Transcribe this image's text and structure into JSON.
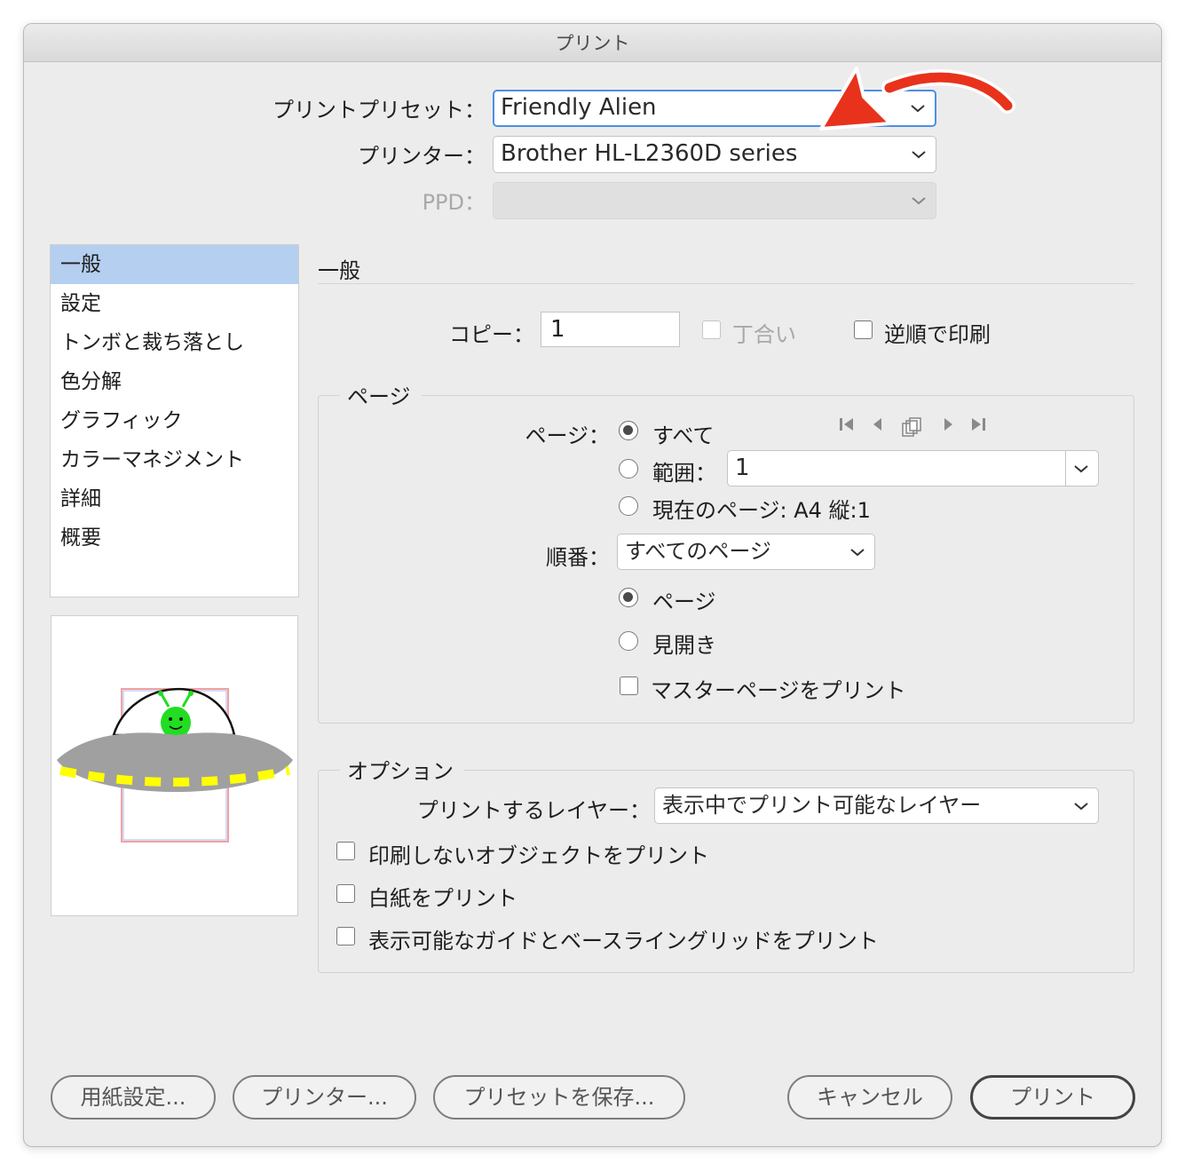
{
  "window": {
    "title": "プリント"
  },
  "preset": {
    "label": "プリントプリセット：",
    "value": "Friendly Alien"
  },
  "printer": {
    "label": "プリンター：",
    "value": "Brother HL-L2360D series"
  },
  "ppd": {
    "label": "PPD：",
    "value": ""
  },
  "sidebar": {
    "items": [
      {
        "label": "一般",
        "selected": true
      },
      {
        "label": "設定"
      },
      {
        "label": "トンボと裁ち落とし"
      },
      {
        "label": "色分解"
      },
      {
        "label": "グラフィック"
      },
      {
        "label": "カラーマネジメント"
      },
      {
        "label": "詳細"
      },
      {
        "label": "概要"
      }
    ]
  },
  "general": {
    "heading": "一般",
    "copies_label": "コピー：",
    "copies_value": "1",
    "collate_label": "丁合い",
    "reverse_label": "逆順で印刷"
  },
  "pages": {
    "group_title": "ページ",
    "pages_label": "ページ：",
    "all_label": "すべて",
    "range_label": "範囲：",
    "range_value": "1",
    "current_label": "現在のページ: A4 縦:1",
    "sequence_label": "順番：",
    "sequence_value": "すべてのページ",
    "page_label": "ページ",
    "spreads_label": "見開き",
    "master_label": "マスターページをプリント"
  },
  "options": {
    "group_title": "オプション",
    "layers_label": "プリントするレイヤー：",
    "layers_value": "表示中でプリント可能なレイヤー",
    "nonprint_label": "印刷しないオブジェクトをプリント",
    "blank_label": "白紙をプリント",
    "guides_label": "表示可能なガイドとベースライングリッドをプリント"
  },
  "buttons": {
    "page_setup": "用紙設定...",
    "printer": "プリンター...",
    "save_preset": "プリセットを保存...",
    "cancel": "キャンセル",
    "print": "プリント"
  },
  "colors": {
    "focus": "#4d8fe6",
    "selection": "#b4cff0",
    "annotation_arrow": "#e8321c",
    "alien": "#22dd22",
    "ufo": "#a0a0a0",
    "ufo_lights": "#ffff00"
  }
}
